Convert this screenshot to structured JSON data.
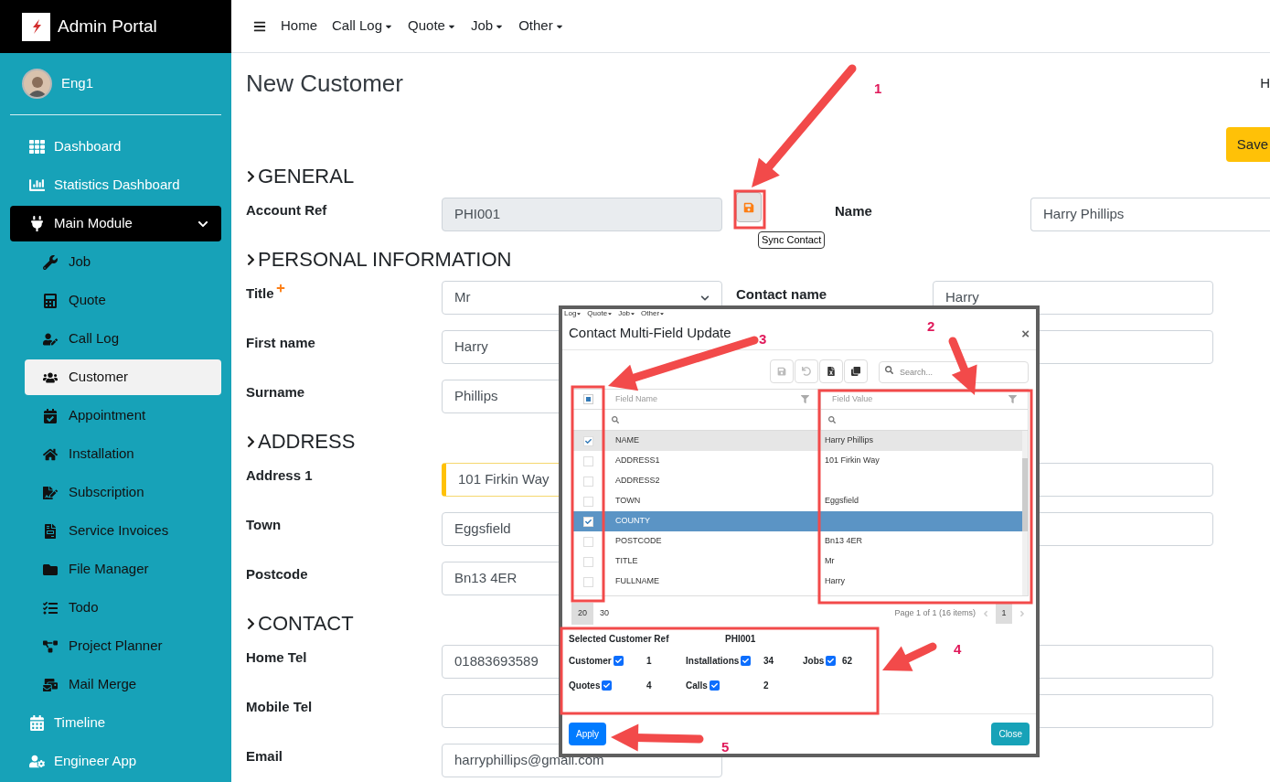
{
  "sidebar": {
    "brand": "Admin Portal",
    "user": "Eng1",
    "items": [
      {
        "label": "Dashboard",
        "selected": false
      },
      {
        "label": "Statistics Dashboard",
        "selected": false
      },
      {
        "label": "Main Module",
        "selected": true,
        "expanded": true,
        "children": [
          {
            "label": "Job",
            "selected": false
          },
          {
            "label": "Quote",
            "selected": false
          },
          {
            "label": "Call Log",
            "selected": false
          },
          {
            "label": "Customer",
            "selected": true
          },
          {
            "label": "Appointment",
            "selected": false
          },
          {
            "label": "Installation",
            "selected": false
          },
          {
            "label": "Subscription",
            "selected": false
          },
          {
            "label": "Service Invoices",
            "selected": false
          },
          {
            "label": "File Manager",
            "selected": false
          },
          {
            "label": "Todo",
            "selected": false
          },
          {
            "label": "Project Planner",
            "selected": false
          },
          {
            "label": "Mail Merge",
            "selected": false
          }
        ]
      },
      {
        "label": "Timeline",
        "selected": false
      },
      {
        "label": "Engineer App",
        "selected": false
      }
    ]
  },
  "nav": [
    {
      "label": "Home",
      "dropdown": false
    },
    {
      "label": "Call Log",
      "dropdown": true
    },
    {
      "label": "Quote",
      "dropdown": true
    },
    {
      "label": "Job",
      "dropdown": true
    },
    {
      "label": "Other",
      "dropdown": true
    }
  ],
  "page": {
    "title": "New Customer",
    "corner_text": "H",
    "save_button": "Save",
    "sections": [
      {
        "heading": "GENERAL",
        "rows": [
          {
            "kind": "account",
            "label": "Account Ref",
            "value": "PHI001",
            "disabled": true,
            "sync_tooltip": "Sync Contact",
            "right_label": "Name",
            "right_value": "Harry Phillips"
          }
        ]
      },
      {
        "heading": "PERSONAL INFORMATION",
        "rows": [
          {
            "kind": "select",
            "label": "Title",
            "required": true,
            "value": "Mr",
            "right_label": "Contact name",
            "right_value": "Harry"
          },
          {
            "kind": "text",
            "label": "First name",
            "value": "Harry",
            "right_field": true
          },
          {
            "kind": "text",
            "label": "Surname",
            "value": "Phillips"
          }
        ]
      },
      {
        "heading": "ADDRESS",
        "rows": [
          {
            "kind": "text",
            "label": "Address 1",
            "value": "101 Firkin Way",
            "focused": true,
            "right_field": true
          },
          {
            "kind": "text",
            "label": "Town",
            "value": "Eggsfield",
            "right_field": true
          },
          {
            "kind": "text",
            "label": "Postcode",
            "value": "Bn13 4ER"
          }
        ]
      },
      {
        "heading": "CONTACT",
        "rows": [
          {
            "kind": "text",
            "label": "Home Tel",
            "value": "01883693589",
            "right_field": true
          },
          {
            "kind": "text",
            "label": "Mobile Tel",
            "right_field": true
          },
          {
            "kind": "text",
            "label": "Email",
            "value": "harryphillips@gmail.com"
          }
        ]
      }
    ]
  },
  "modal": {
    "menu_strip": [
      "Log",
      "Quote",
      "Job",
      "Other"
    ],
    "title": "Contact Multi-Field Update",
    "close": "×",
    "search_placeholder": "Search...",
    "select_all_partial": true,
    "columns": [
      "Field Name",
      "Field Value"
    ],
    "rows": [
      {
        "field": "NAME",
        "value": "Harry Phillips",
        "checked": true,
        "selected": false,
        "highlighted": true
      },
      {
        "field": "ADDRESS1",
        "value": "101 Firkin Way",
        "checked": false,
        "selected": false
      },
      {
        "field": "ADDRESS2",
        "checked": false,
        "selected": false
      },
      {
        "field": "TOWN",
        "value": "Eggsfield",
        "checked": false,
        "selected": false
      },
      {
        "field": "COUNTY",
        "checked": true,
        "selected": true
      },
      {
        "field": "POSTCODE",
        "value": "Bn13 4ER",
        "checked": false,
        "selected": false
      },
      {
        "field": "TITLE",
        "value": "Mr",
        "checked": false,
        "selected": false
      },
      {
        "field": "FULLNAME",
        "value": "Harry",
        "checked": false,
        "selected": false
      }
    ],
    "page_sizes": [
      {
        "label": "20",
        "selected": true
      },
      {
        "label": "30",
        "selected": false
      }
    ],
    "page_info": "Page 1 of 1 (16 items)",
    "pages": [
      {
        "label": "1",
        "selected": true
      }
    ],
    "summary": {
      "ref_label": "Selected Customer Ref",
      "ref_value": "PHI001",
      "counts": [
        {
          "label": "Customer",
          "checked": true,
          "count": "1"
        },
        {
          "label": "Installations",
          "checked": true,
          "count": "34"
        },
        {
          "label": "Jobs",
          "checked": true,
          "count": "62"
        },
        {
          "label": "Quotes",
          "checked": true,
          "count": "4"
        },
        {
          "label": "Calls",
          "checked": true,
          "count": "2"
        }
      ]
    },
    "apply_button": "Apply",
    "close_button": "Close"
  },
  "annotations": [
    {
      "number": "1"
    },
    {
      "number": "2"
    },
    {
      "number": "3"
    },
    {
      "number": "4"
    },
    {
      "number": "5"
    }
  ]
}
